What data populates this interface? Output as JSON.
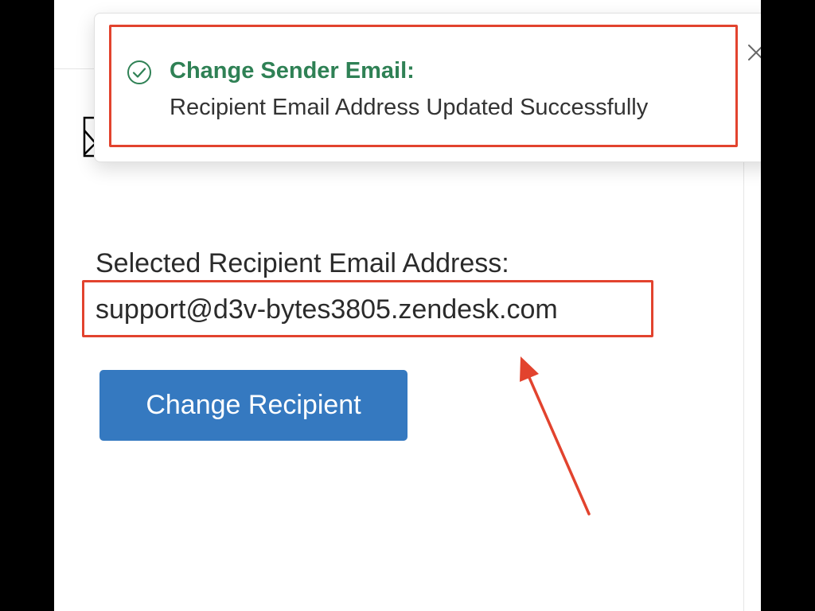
{
  "toast": {
    "title": "Change Sender Email:",
    "message": "Recipient Email Address Updated Successfully",
    "status": "success",
    "icon": "check-circle-icon",
    "close_icon": "close-icon",
    "accent_color": "#2f8155"
  },
  "recipient": {
    "label": "Selected Recipient Email Address:",
    "email": "support@d3v-bytes3805.zendesk.com"
  },
  "button": {
    "label": "Change Recipient",
    "color": "#3579c0"
  },
  "annotations": {
    "highlight_color": "#e2432e"
  }
}
